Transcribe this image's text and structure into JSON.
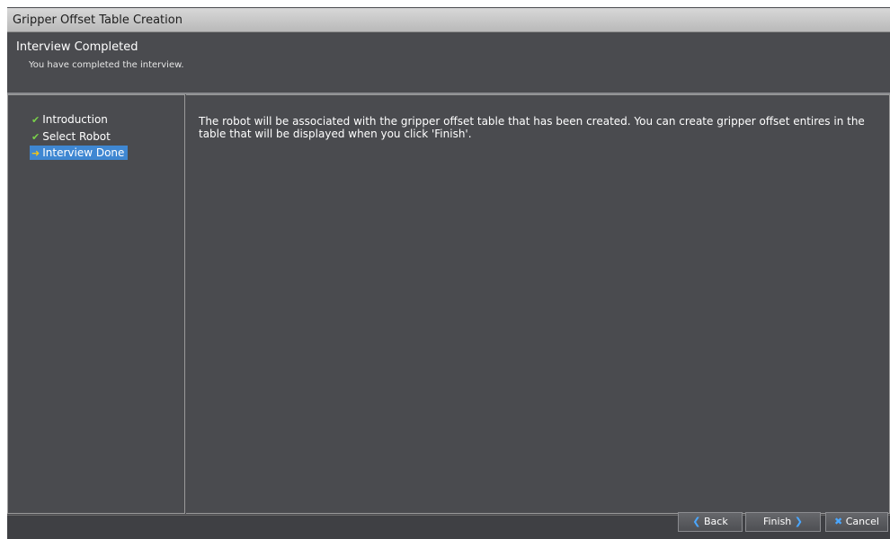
{
  "window": {
    "title": "Gripper Offset Table Creation"
  },
  "header": {
    "title": "Interview Completed",
    "subtitle": "You have completed the interview."
  },
  "nav": {
    "items": [
      {
        "label": "Introduction",
        "icon": "check-icon",
        "state": "done"
      },
      {
        "label": "Select Robot",
        "icon": "check-icon",
        "state": "done"
      },
      {
        "label": "Interview Done",
        "icon": "arrow-right-icon",
        "state": "current"
      }
    ]
  },
  "content": {
    "text": "The robot will be associated with the gripper offset table that has been created. You can create gripper offset entires in the table that will be displayed when you click 'Finish'."
  },
  "footer": {
    "back_label": "Back",
    "finish_label": "Finish",
    "cancel_label": "Cancel"
  },
  "colors": {
    "background": "#4a4b4f",
    "selected": "#3f87d2",
    "check": "#79d14a",
    "arrow": "#f0c419",
    "button_icon": "#4aa7ff"
  }
}
